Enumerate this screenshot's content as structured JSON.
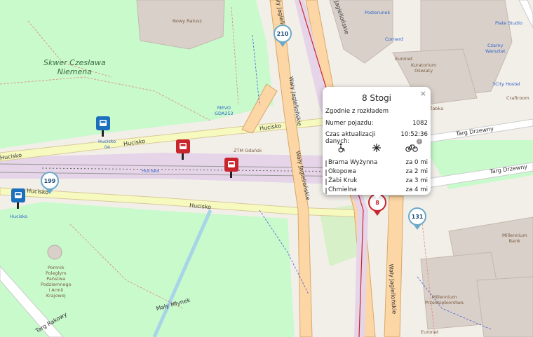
{
  "map": {
    "place_labels": {
      "park_name": "Skwer Czesława\nNiemena",
      "city_hall": "Nowy Ratusz",
      "ztm": "ZTM Gdańsk",
      "mevo": "MEVO\nGDA252",
      "monument": "Pomnik\nPoległym\nPaństwa\nPodziemnego\ni Armii\nKrajowej",
      "kuratorium": "Kuratorium\nOświaty",
      "euronet_top": "Euronet",
      "euronet_bottom": "Euronet",
      "cornerd": "Cornerd",
      "millennium": "Millennium\nBank",
      "przedsiebiorstwa": "Millennium\nPrzedsiębiorstwa",
      "piate_studio": "Piate Studio",
      "czarny": "Czarny\nWarsztat",
      "hostel": "3City Hostel",
      "craftroom": "Craftroom",
      "zabka": "Żabka",
      "posterunek": "Posterunek",
      "hucisko_stop_label_1": "Hucisko\n04",
      "hucisko_stop_label_2": "Hucisko",
      "hucisko_stop_label_3": "Hucisko"
    },
    "street_labels": {
      "hucisko_1": "Hucisko",
      "hucisko_2": "Hucisko",
      "hucisko_3": "Hucisko",
      "hucisko_4": "Hucisko",
      "hucisko_5": "Hucisko",
      "waly_1": "Wały Jagiellońskie",
      "waly_2": "Wały Jagiellońskie",
      "waly_3": "Wały Jagiellońskie",
      "waly_4": "Wały Jagiellońskie",
      "waly_5": "Wały Jagiellońskie",
      "targ_1": "Targ Drzewny",
      "targ_2": "Targ Drzewny",
      "targ_3": "Targ Rakowy",
      "maly_mlyn": "Mały Młynek"
    },
    "vehicle_markers": [
      "210",
      "199",
      "131"
    ],
    "selected_vehicle_marker": "8",
    "colors": {
      "park": "#c8facc",
      "major_road": "#fcd6a4",
      "secondary_road": "#f7fabf",
      "tram_area": "#e6d4e8",
      "bus_stop": "#1c6fbd",
      "tram_stop": "#c9252c"
    }
  },
  "popup": {
    "title": "8 Stogi",
    "close_icon": "×",
    "status": "Zgodnie z rozkładem",
    "vehicle_label": "Numer pojazdu:",
    "vehicle_number": "1082",
    "update_label": "Czas aktualizacji danych:",
    "update_time": "10:52:36",
    "icons": [
      "wheelchair-icon",
      "air-conditioning-icon",
      "bicycle-icon"
    ],
    "info_badge": "i",
    "next_stops": [
      {
        "name": "Brama Wyżynna",
        "eta": "za 0 mi"
      },
      {
        "name": "Okopowa",
        "eta": "za 2 mi"
      },
      {
        "name": "Żabi Kruk",
        "eta": "za 3 mi"
      },
      {
        "name": "Chmielna",
        "eta": "za 4 mi"
      }
    ]
  }
}
